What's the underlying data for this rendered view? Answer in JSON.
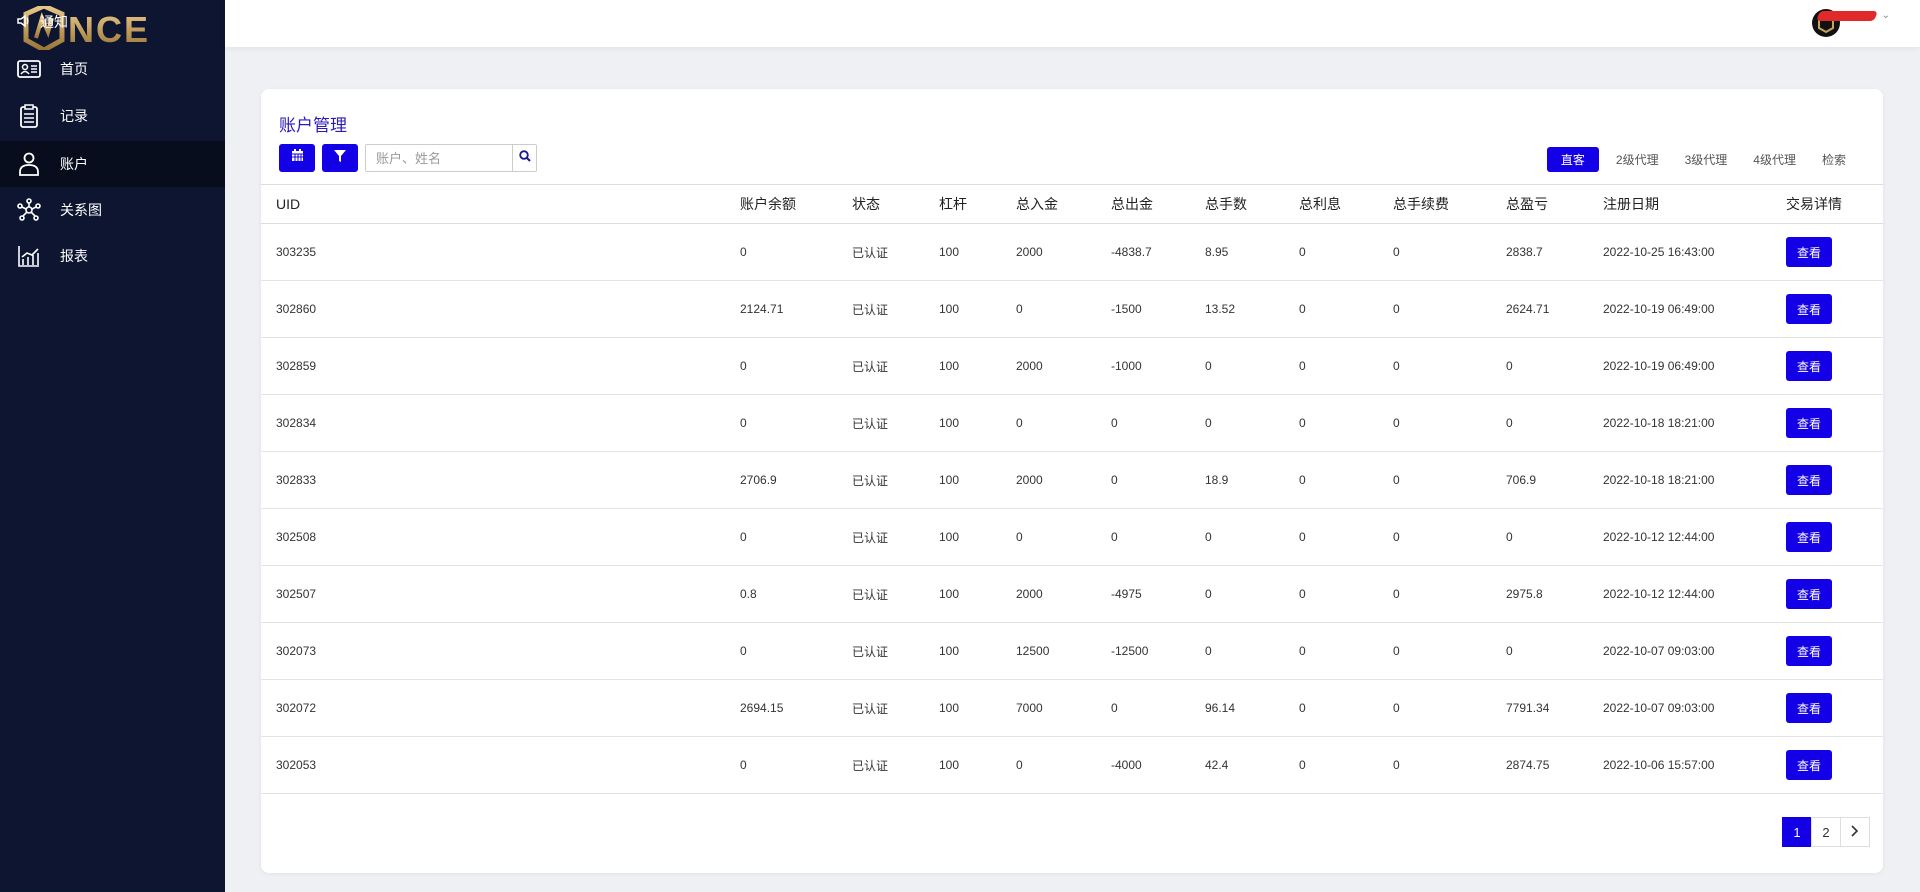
{
  "brand": {
    "logo_text": "NCE",
    "accent": "#1400e6",
    "sidebar_bg": "#0d1530"
  },
  "notice": {
    "label": "通知",
    "icon": "speaker-icon"
  },
  "sidebar": {
    "items": [
      {
        "label": "首页",
        "icon": "id-card-icon"
      },
      {
        "label": "记录",
        "icon": "clipboard-icon"
      },
      {
        "label": "账户",
        "icon": "user-icon",
        "active": true
      },
      {
        "label": "关系图",
        "icon": "network-icon"
      },
      {
        "label": "报表",
        "icon": "chart-icon"
      }
    ]
  },
  "page": {
    "title": "账户管理",
    "search_placeholder": "账户、姓名"
  },
  "tabs": [
    {
      "label": "直客",
      "active": true
    },
    {
      "label": "2级代理"
    },
    {
      "label": "3级代理"
    },
    {
      "label": "4级代理"
    },
    {
      "label": "检索"
    }
  ],
  "table": {
    "headers": [
      "UID",
      "账户余额",
      "状态",
      "杠杆",
      "总入金",
      "总出金",
      "总手数",
      "总利息",
      "总手续费",
      "总盈亏",
      "注册日期",
      "交易详情"
    ],
    "button_label": "查看",
    "rows": [
      [
        "303235",
        "0",
        "已认证",
        "100",
        "2000",
        "-4838.7",
        "8.95",
        "0",
        "0",
        "2838.7",
        "2022-10-25 16:43:00"
      ],
      [
        "302860",
        "2124.71",
        "已认证",
        "100",
        "0",
        "-1500",
        "13.52",
        "0",
        "0",
        "2624.71",
        "2022-10-19 06:49:00"
      ],
      [
        "302859",
        "0",
        "已认证",
        "100",
        "2000",
        "-1000",
        "0",
        "0",
        "0",
        "0",
        "2022-10-19 06:49:00"
      ],
      [
        "302834",
        "0",
        "已认证",
        "100",
        "0",
        "0",
        "0",
        "0",
        "0",
        "0",
        "2022-10-18 18:21:00"
      ],
      [
        "302833",
        "2706.9",
        "已认证",
        "100",
        "2000",
        "0",
        "18.9",
        "0",
        "0",
        "706.9",
        "2022-10-18 18:21:00"
      ],
      [
        "302508",
        "0",
        "已认证",
        "100",
        "0",
        "0",
        "0",
        "0",
        "0",
        "0",
        "2022-10-12 12:44:00"
      ],
      [
        "302507",
        "0.8",
        "已认证",
        "100",
        "2000",
        "-4975",
        "0",
        "0",
        "0",
        "2975.8",
        "2022-10-12 12:44:00"
      ],
      [
        "302073",
        "0",
        "已认证",
        "100",
        "12500",
        "-12500",
        "0",
        "0",
        "0",
        "0",
        "2022-10-07 09:03:00"
      ],
      [
        "302072",
        "2694.15",
        "已认证",
        "100",
        "7000",
        "0",
        "96.14",
        "0",
        "0",
        "7791.34",
        "2022-10-07 09:03:00"
      ],
      [
        "302053",
        "0",
        "已认证",
        "100",
        "0",
        "-4000",
        "42.4",
        "0",
        "0",
        "2874.75",
        "2022-10-06 15:57:00"
      ]
    ]
  },
  "pagination": {
    "pages": [
      "1",
      "2"
    ],
    "current": "1",
    "next_icon": "chevron-right-icon"
  }
}
